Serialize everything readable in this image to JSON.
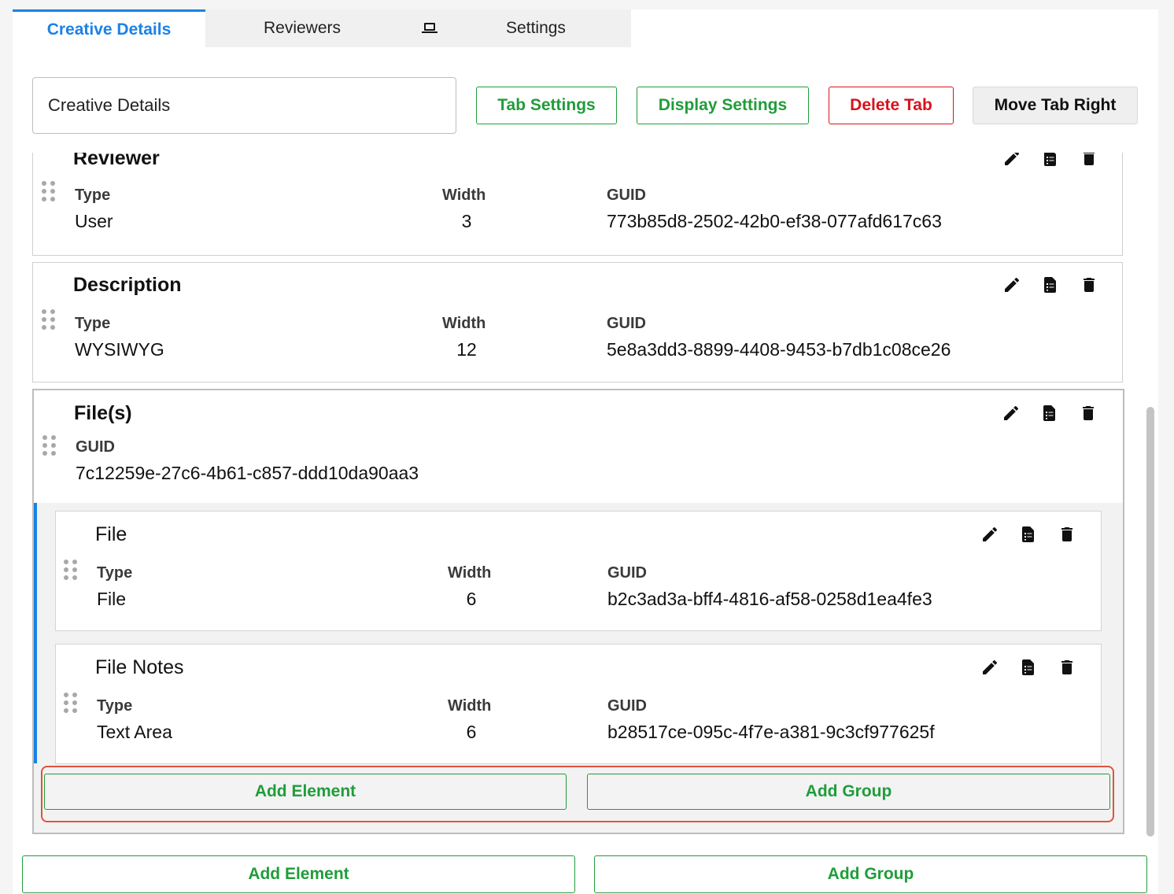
{
  "tabs": [
    {
      "label": "Creative Details",
      "active": true
    },
    {
      "label": "Reviewers"
    },
    {
      "label": "",
      "icon": "laptop-icon"
    },
    {
      "label": "Settings"
    }
  ],
  "toolbar": {
    "tab_name_value": "Creative Details",
    "tab_settings": "Tab Settings",
    "display_settings": "Display Settings",
    "delete_tab": "Delete Tab",
    "move_tab_right": "Move Tab Right"
  },
  "labels": {
    "type": "Type",
    "width": "Width",
    "guid": "GUID"
  },
  "elements": [
    {
      "title": "Reviewer",
      "type": "User",
      "width": "3",
      "guid": "773b85d8-2502-42b0-ef38-077afd617c63"
    },
    {
      "title": "Description",
      "type": "WYSIWYG",
      "width": "12",
      "guid": "5e8a3dd3-8899-4408-9453-b7db1c08ce26"
    }
  ],
  "group": {
    "title": "File(s)",
    "guid": "7c12259e-27c6-4b61-c857-ddd10da90aa3",
    "children": [
      {
        "title": "File",
        "type": "File",
        "width": "6",
        "guid": "b2c3ad3a-bff4-4816-af58-0258d1ea4fe3"
      },
      {
        "title": "File Notes",
        "type": "Text Area",
        "width": "6",
        "guid": "b28517ce-095c-4f7e-a381-9c3cf977625f"
      }
    ],
    "add_element": "Add Element",
    "add_group": "Add Group"
  },
  "bottom": {
    "add_element": "Add Element",
    "add_group": "Add Group"
  },
  "icons": [
    "pencil-icon",
    "document-icon",
    "trash-icon"
  ],
  "colors": {
    "accent": "#1a82e6",
    "green": "#1f9d3a",
    "red": "#d6131d",
    "highlight": "#e0533f"
  }
}
